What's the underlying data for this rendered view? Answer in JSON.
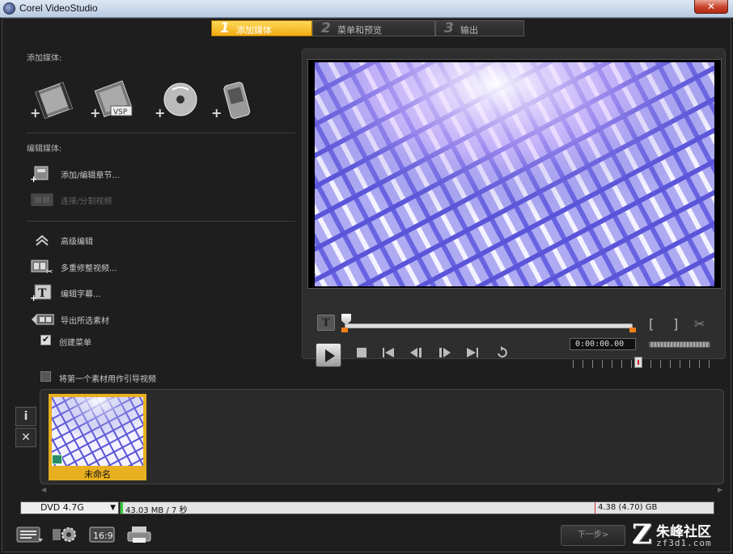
{
  "window": {
    "title": "Corel VideoStudio",
    "close_label": "✕"
  },
  "steps": [
    {
      "num": "1",
      "label": "添加媒体"
    },
    {
      "num": "2",
      "label": "菜单和预览"
    },
    {
      "num": "3",
      "label": "输出"
    }
  ],
  "left": {
    "add_media_label": "添加媒体:",
    "add_media_icons": [
      "video-clip-icon",
      "vsp-project-icon",
      "dvd-disc-icon",
      "mobile-device-icon"
    ],
    "edit_media_label": "编辑媒体:",
    "add_edit_chapters": "添加/编辑章节...",
    "join_split_video": "连接/分割视频",
    "advanced_edit": "高级编辑",
    "multi_trim": "多重修整视频...",
    "edit_subtitles": "编辑字幕...",
    "export_selected": "导出所选素材",
    "create_menu": "创建菜单",
    "create_menu_checked": true,
    "first_clip_intro": "将第一个素材用作引导视频",
    "first_clip_intro_checked": false
  },
  "player": {
    "timecode": "0:00:00.00",
    "mark_in": "[",
    "mark_out": "]",
    "cut": "✂",
    "title_btn": "T",
    "scrub_position": 0
  },
  "timeline": {
    "info_btn": "i",
    "delete_btn": "✕",
    "clip_name": "未命名"
  },
  "status": {
    "disc_type": "DVD 4.7G",
    "used": "43.03 MB / 7 秒",
    "total": "4.38 (4.70) GB"
  },
  "footer": {
    "next_button": "下一步>",
    "watermark_cn": "朱峰社区",
    "watermark_en": "zf3d1.com"
  },
  "colors": {
    "active_step": "#f2ab12",
    "clip_border": "#e8b020",
    "mark_orange": "#f0801a"
  }
}
